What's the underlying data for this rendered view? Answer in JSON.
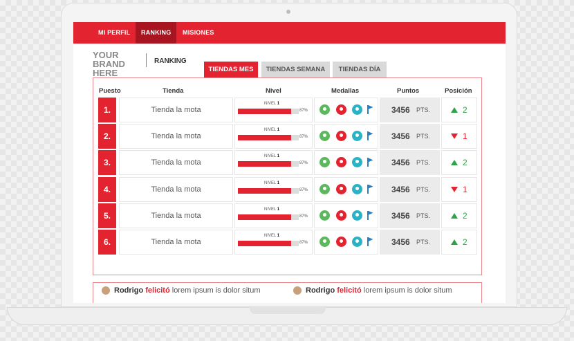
{
  "nav": {
    "items": [
      {
        "label": "MI PERFIL"
      },
      {
        "label": "RANKING"
      },
      {
        "label": "MISIONES"
      }
    ]
  },
  "header": {
    "brand": "YOUR BRAND HERE",
    "title": "RANKING",
    "tabs": [
      {
        "label": "TIENDAS MES"
      },
      {
        "label": "TIENDAS SEMANA"
      },
      {
        "label": "TIENDAS DÍA"
      }
    ]
  },
  "table": {
    "columns": [
      "Puesto",
      "Tienda",
      "Nivel",
      "Medallas",
      "Puntos",
      "Posición"
    ],
    "rows": [
      {
        "rank": "1.",
        "store": "Tienda la mota",
        "nivel_word": "NIVEL",
        "nivel_num": "1",
        "progress": 0.87,
        "pct": "87%",
        "points": "3456",
        "unit": "PTS.",
        "trend": "up",
        "position": "2"
      },
      {
        "rank": "2.",
        "store": "Tienda la mota",
        "nivel_word": "NIVEL",
        "nivel_num": "1",
        "progress": 0.87,
        "pct": "87%",
        "points": "3456",
        "unit": "PTS.",
        "trend": "down",
        "position": "1"
      },
      {
        "rank": "3.",
        "store": "Tienda la mota",
        "nivel_word": "NIVEL",
        "nivel_num": "1",
        "progress": 0.87,
        "pct": "87%",
        "points": "3456",
        "unit": "PTS.",
        "trend": "up",
        "position": "2"
      },
      {
        "rank": "4.",
        "store": "Tienda la mota",
        "nivel_word": "NIVEL",
        "nivel_num": "1",
        "progress": 0.87,
        "pct": "87%",
        "points": "3456",
        "unit": "PTS.",
        "trend": "down",
        "position": "1"
      },
      {
        "rank": "5.",
        "store": "Tienda la mota",
        "nivel_word": "NIVEL",
        "nivel_num": "1",
        "progress": 0.87,
        "pct": "87%",
        "points": "3456",
        "unit": "PTS.",
        "trend": "up",
        "position": "2"
      },
      {
        "rank": "6.",
        "store": "Tienda la mota",
        "nivel_word": "NIVEL",
        "nivel_num": "1",
        "progress": 0.87,
        "pct": "87%",
        "points": "3456",
        "unit": "PTS.",
        "trend": "up",
        "position": "2"
      }
    ]
  },
  "feed": {
    "items": [
      {
        "name": "Rodrigo",
        "verb": "felicitó",
        "text": "lorem ipsum is dolor situm"
      },
      {
        "name": "Rodrigo",
        "verb": "felicitó",
        "text": "lorem ipsum is dolor situm"
      }
    ]
  },
  "icons": {
    "medals": [
      "user-medal-icon",
      "target-medal-icon",
      "group-medal-icon",
      "flag-icon"
    ],
    "trend": [
      "arrow-up-icon",
      "arrow-down-icon"
    ]
  },
  "colors": {
    "accent": "#e3232f",
    "accent_dark": "#a81520",
    "up": "#2fa34a",
    "down": "#e3232f"
  }
}
